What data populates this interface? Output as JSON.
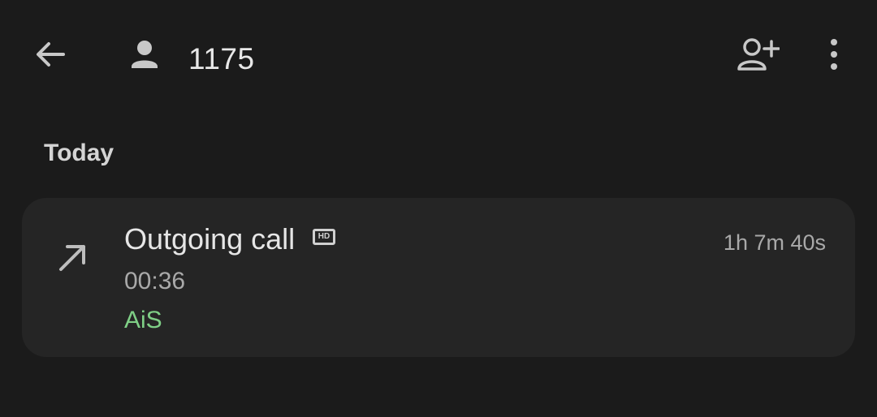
{
  "header": {
    "title": "1175",
    "back_icon": "arrow-back-icon",
    "contact_icon": "person-icon",
    "add_contact_icon": "person-add-icon",
    "more_icon": "more-vert-icon"
  },
  "section": {
    "label": "Today"
  },
  "call": {
    "type": "Outgoing call",
    "hd_badge": "HD",
    "duration": "00:36",
    "sim": "AiS",
    "time_ago": "1h 7m 40s",
    "direction_icon": "call-made-icon"
  },
  "colors": {
    "background": "#1b1b1b",
    "card": "#252525",
    "sim_accent": "#7fcf86",
    "text_primary": "#e6e6e6",
    "text_secondary": "#a9a9a9"
  }
}
